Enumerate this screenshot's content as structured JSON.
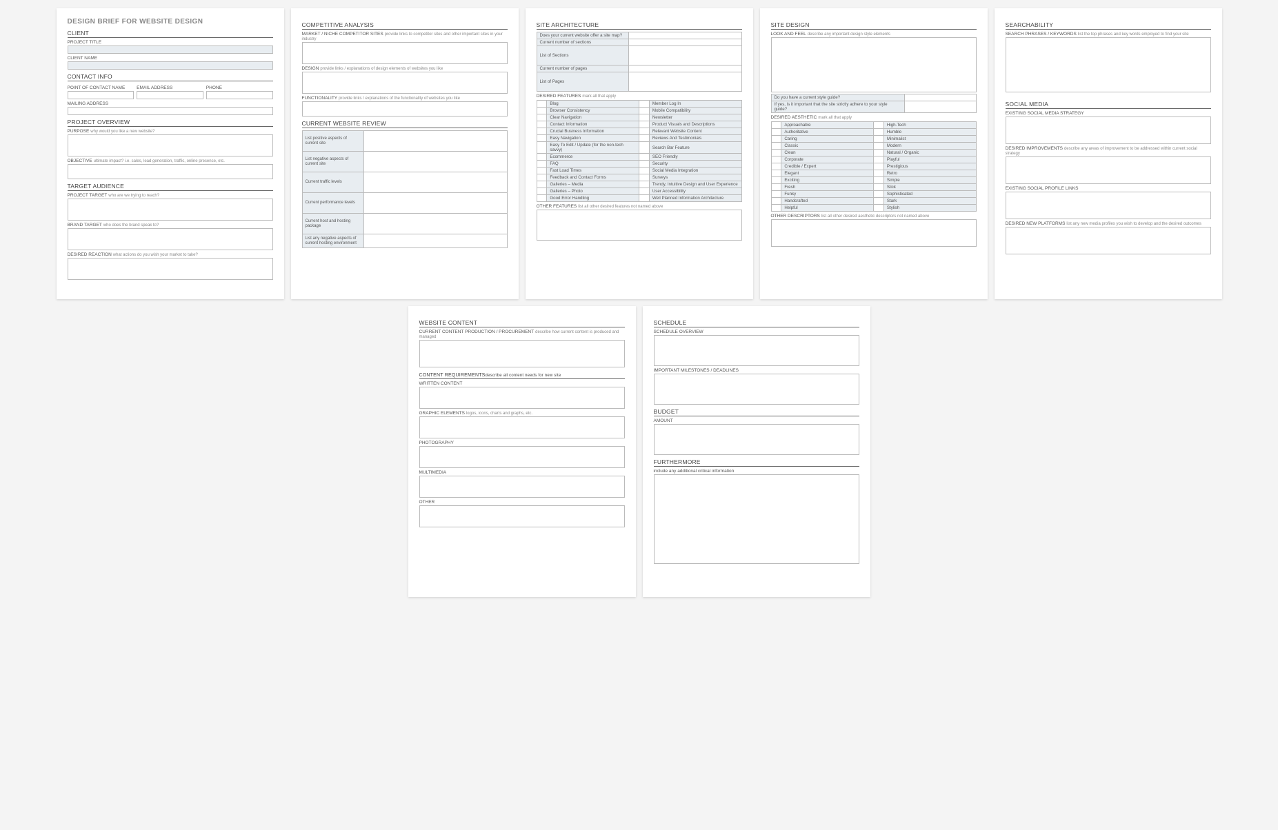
{
  "docTitle": "DESIGN BRIEF FOR WEBSITE DESIGN",
  "page1": {
    "client": "CLIENT",
    "projectTitle": "PROJECT TITLE",
    "clientName": "CLIENT NAME",
    "contactInfo": "CONTACT INFO",
    "pocName": "POINT OF CONTACT NAME",
    "email": "EMAIL ADDRESS",
    "phone": "PHONE",
    "mailing": "MAILING ADDRESS",
    "projOverview": "PROJECT OVERVIEW",
    "purpose": "PURPOSE",
    "purposeHint": "why would you like a new website?",
    "objective": "OBJECTIVE",
    "objectiveHint": "ultimate impact?  i.e. sales, lead generation, traffic, online presence, etc.",
    "targetAudience": "TARGET AUDIENCE",
    "projectTarget": "PROJECT TARGET",
    "projectTargetHint": "who are we trying to reach?",
    "brandTarget": "BRAND TARGET",
    "brandTargetHint": "who does the brand speak to?",
    "desiredReaction": "DESIRED REACTION",
    "desiredReactionHint": "what actions do you wish your market to take?"
  },
  "page2": {
    "compAnalysis": "COMPETITIVE ANALYSIS",
    "marketSites": "MARKET / NICHE COMPETITOR SITES",
    "marketSitesHint": "provide links to competitor sites and other important sites in your industry",
    "design": "DESIGN",
    "designHint": "provide links / explanations of design elements of websites you like",
    "functionality": "FUNCTIONALITY",
    "functionalityHint": "provide links / explanations of the functionality of websites you like",
    "currentReview": "CURRENT WEBSITE REVIEW",
    "reviewRows": [
      "List positive aspects of current site",
      "List negative aspects of current site",
      "Current traffic levels",
      "Current performance levels",
      "Current host and hosting package",
      "List any negative aspects of current hosting environment"
    ]
  },
  "page3": {
    "siteArch": "SITE ARCHITECTURE",
    "archRows": [
      "Does your current website offer a site map?",
      "Current number of sections",
      "List of Sections",
      "Current number of pages",
      "List of Pages"
    ],
    "desiredFeatures": "DESIRED FEATURES",
    "desiredFeaturesHint": "mark all that apply",
    "featuresLeft": [
      "Blog",
      "Browser Consistency",
      "Clear Navigation",
      "Contact Information",
      "Crucial Business Information",
      "Easy Navigation",
      "Easy To Edit / Update (for the non-tech savvy)",
      "Ecommerce",
      "FAQ",
      "Fast Load Times",
      "Feedback and Contact Forms",
      "Galleries – Media",
      "Galleries – Photo",
      "Good Error Handling"
    ],
    "featuresRight": [
      "Member Log In",
      "Mobile Compatibility",
      "Newsletter",
      "Product Visuals and Descriptions",
      "Relevant Website Content",
      "Reviews And Testimonials",
      "Search Bar Feature",
      "SEO Friendly",
      "Security",
      "Social Media Integration",
      "Surveys",
      "Trendy, Intuitive Design and User Experience",
      "User Accessibility",
      "Well Planned Information Architecture"
    ],
    "otherFeatures": "OTHER FEATURES",
    "otherFeaturesHint": "list all other desired features not named above"
  },
  "page4": {
    "siteDesign": "SITE DESIGN",
    "lookFeel": "LOOK AND FEEL",
    "lookFeelHint": "describe any important design style elements",
    "styleGuideQ1": "Do you have a current style guide?",
    "styleGuideQ2": "If yes, is it important that the site strictly adhere to your style guide?",
    "desiredAesthetic": "DESIRED AESTHETIC",
    "desiredAestheticHint": "mark all that apply",
    "aestheticLeft": [
      "Approachable",
      "Authoritative",
      "Caring",
      "Classic",
      "Clean",
      "Corporate",
      "Credible / Expert",
      "Elegant",
      "Exciting",
      "Fresh",
      "Funky",
      "Handcrafted",
      "Helpful"
    ],
    "aestheticRight": [
      "High-Tech",
      "Humble",
      "Minimalist",
      "Modern",
      "Natural / Organic",
      "Playful",
      "Prestigious",
      "Retro",
      "Simple",
      "Slick",
      "Sophisticated",
      "Stark",
      "Stylish"
    ],
    "otherDescriptors": "OTHER DESCRIPTORS",
    "otherDescriptorsHint": "list all other desired aesthetic descriptors not named above"
  },
  "page5": {
    "searchability": "SEARCHABILITY",
    "searchPhrases": "SEARCH PHRASES / KEYWORDS",
    "searchPhrasesHint": "list the top phrases and key words employed to find your site",
    "socialMedia": "SOCIAL MEDIA",
    "existingStrategy": "EXISTING SOCIAL MEDIA STRATEGY",
    "desiredImprovements": "DESIRED IMPROVEMENTS",
    "desiredImprovementsHint": "describe any areas of improvement to be addressed within current social strategy",
    "existingProfiles": "EXISTING SOCIAL PROFILE LINKS",
    "desiredPlatforms": "DESIRED NEW PLATFORMS",
    "desiredPlatformsHint": "list any new media profiles you wish to develop and the desired outcomes"
  },
  "page6": {
    "websiteContent": "WEBSITE CONTENT",
    "currentContent": "CURRENT CONTENT PRODUCTION / PROCUREMENT",
    "currentContentHint": "describe how current content is produced and managed",
    "contentReq": "CONTENT REQUIREMENTS",
    "contentReqHint": "describe all content needs for new site",
    "written": "WRITTEN CONTENT",
    "graphic": "GRAPHIC ELEMENTS",
    "graphicHint": "logos, icons, charts and graphs, etc.",
    "photography": "PHOTOGRAPHY",
    "multimedia": "MULTIMEDIA",
    "other": "OTHER"
  },
  "page7": {
    "schedule": "SCHEDULE",
    "scheduleOverview": "SCHEDULE OVERVIEW",
    "milestones": "IMPORTANT MILESTONES / DEADLINES",
    "budget": "BUDGET",
    "amount": "AMOUNT",
    "furthermore": "FURTHERMORE",
    "furthermoreHint": "include any additional critical information"
  }
}
